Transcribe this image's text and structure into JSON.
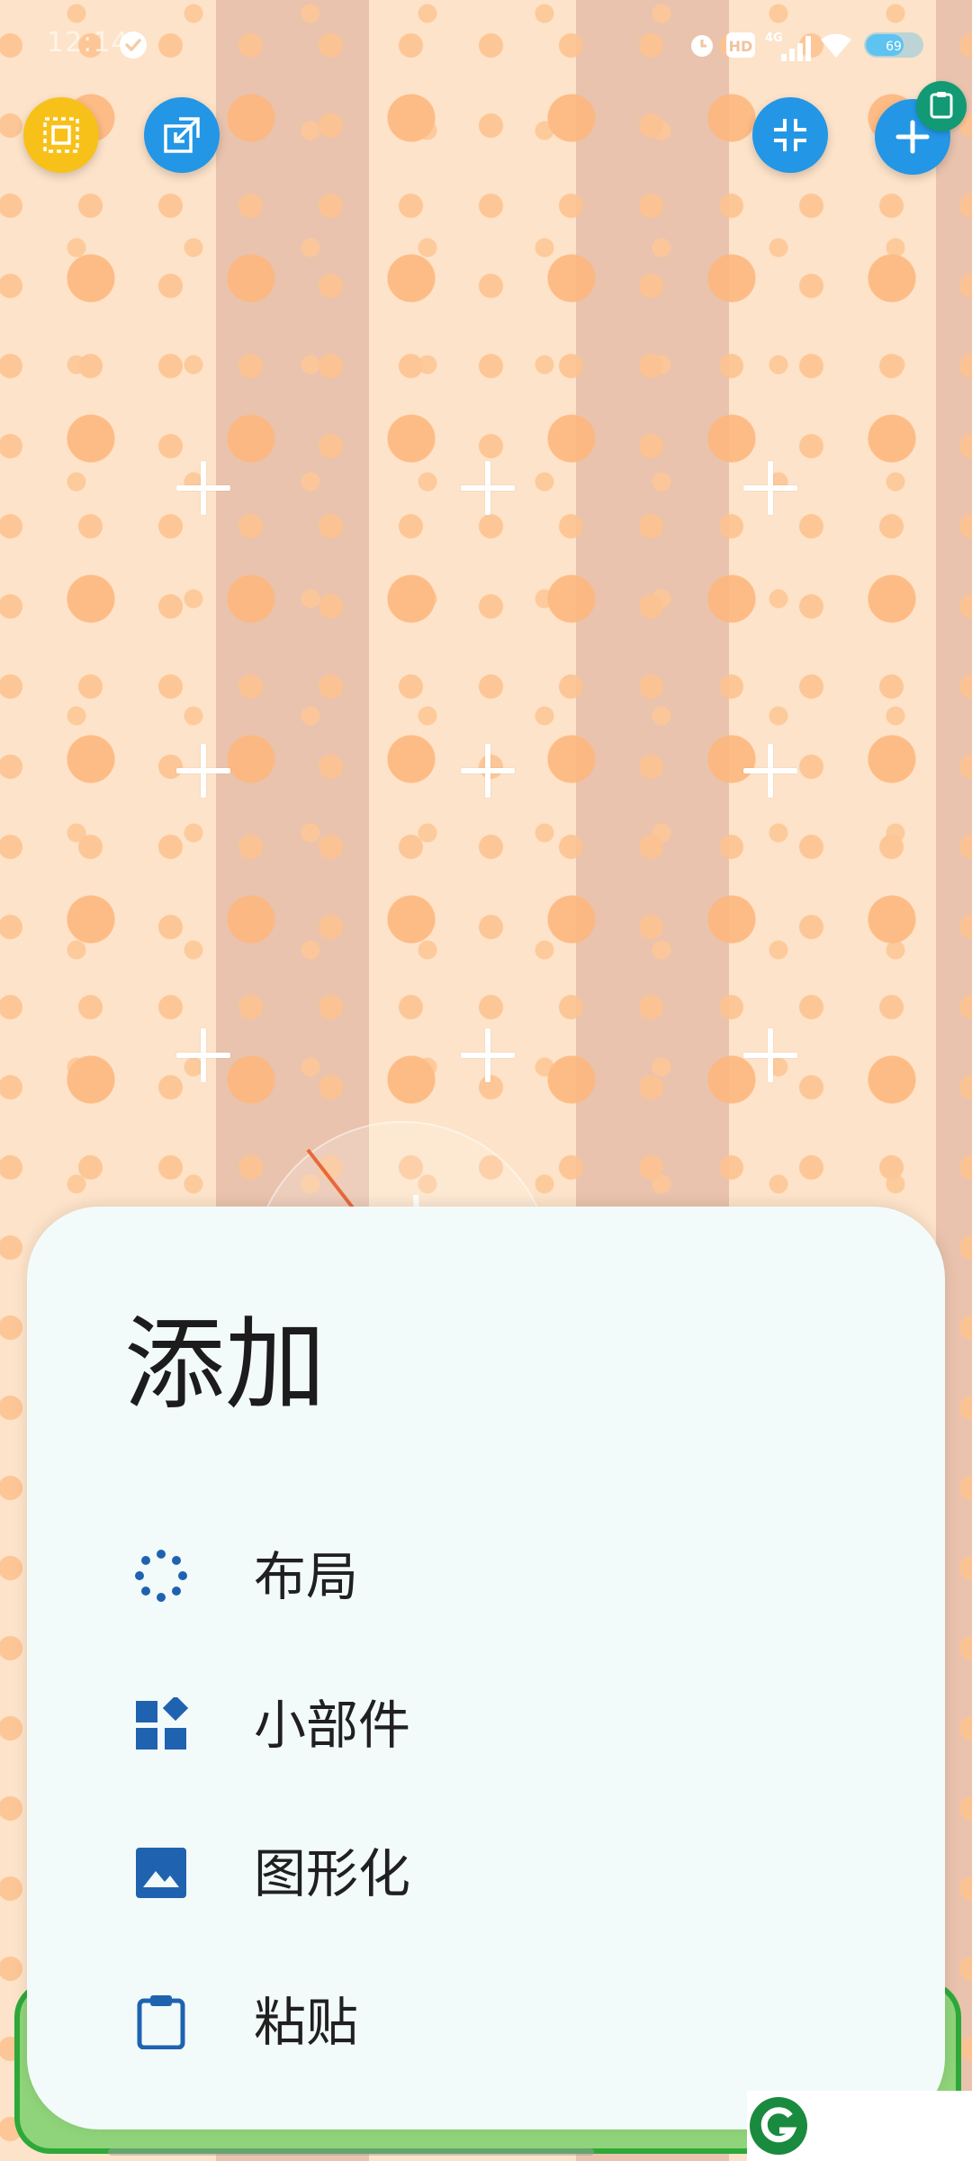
{
  "status_bar": {
    "time": "12:14",
    "network": "4G",
    "hd_label": "HD",
    "battery_level": "69"
  },
  "toolbar": {
    "layout_select_icon": "select-frame-icon",
    "resize_icon": "expand-window-icon",
    "collapse_icon": "collapse-icon",
    "add_icon": "plus-icon",
    "clipboard_badge_icon": "clipboard-icon"
  },
  "add_sheet": {
    "title": "添加",
    "items": [
      {
        "label": "布局",
        "icon": "layout-dots-icon"
      },
      {
        "label": "小部件",
        "icon": "widget-icon"
      },
      {
        "label": "图形化",
        "icon": "image-icon"
      },
      {
        "label": "粘贴",
        "icon": "clipboard-icon"
      }
    ]
  },
  "colors": {
    "accent_blue": "#2496e6",
    "fab_yellow": "#f8c11a",
    "badge_green": "#119a73",
    "icon_blue": "#1f63b0",
    "sheet_bg": "#f3fbfa",
    "wallpaper_light": "#fde3c9",
    "wallpaper_dark": "#e9c3ad",
    "dot_orange": "#fdb77f"
  }
}
